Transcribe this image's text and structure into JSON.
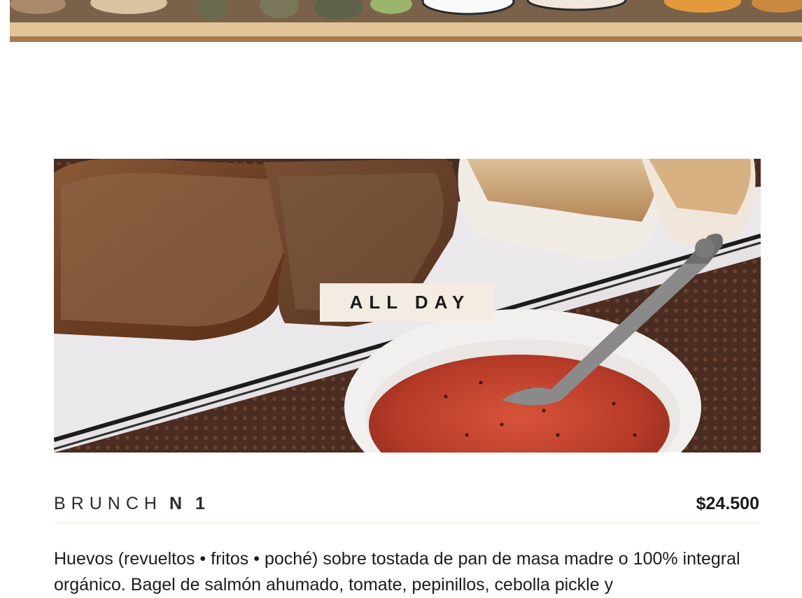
{
  "hero": {
    "badge_label": "ALL DAY"
  },
  "menu_item": {
    "name_prefix": "BRUNCH",
    "name_suffix": "N 1",
    "price": "$24.500",
    "description": "Huevos (revueltos • fritos • poché) sobre tostada de pan de masa madre o 100% integral orgánico. Bagel de salmón ahumado, tomate, pepinillos, cebolla pickle y"
  }
}
